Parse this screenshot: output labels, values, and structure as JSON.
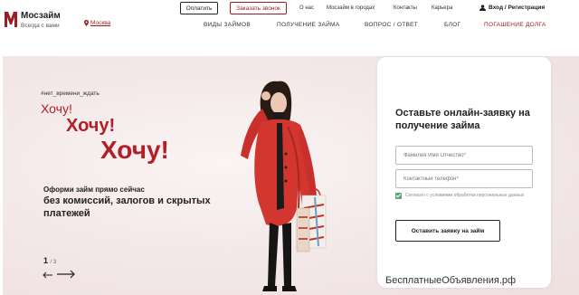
{
  "header": {
    "logo_name": "Мосзайм",
    "logo_tagline": "Всегда с вами",
    "city": "Москва",
    "pay_button": "Оплатить",
    "callback_button": "Заказать звонок",
    "top_links": [
      "О нас",
      "Мосзайм в городах",
      "Контакты",
      "Карьера"
    ],
    "login": "Вход / Регистрация",
    "nav": [
      "ВИДЫ ЗАЙМОВ",
      "ПОЛУЧЕНИЕ ЗАЙМА",
      "ВОПРОС / ОТВЕТ",
      "БЛОГ",
      "ПОГАШЕНИЕ ДОЛГА"
    ]
  },
  "hero": {
    "hashtag": "#нет_времени_ждать",
    "line1": "Хочу!",
    "line2": "Хочу!",
    "line3": "Хочу!",
    "offer_lead": "Оформи займ прямо сейчас",
    "offer_body": "без комиссий, залогов и скрытых платежей",
    "slide_current": "1",
    "slide_total": "/ 3"
  },
  "form": {
    "title": "Оставьте онлайн-заявку на получение займа",
    "name_placeholder": "Фамилия Имя Отчество*",
    "phone_placeholder": "Контактный телефон*",
    "consent_text": "Согласен с условиями обработки персональных данных",
    "consent_checked": true,
    "submit_label": "Оставить заявку на займ"
  },
  "watermark": "БесплатныеОбъявления.рф",
  "colors": {
    "brand": "#9c1c1f",
    "accent_red": "#b31f24",
    "hero_bg": "#f2e6e6",
    "checkbox_green": "#5aa870"
  },
  "icons": {
    "logo": "moszaim-m-logo",
    "city": "location-pin-icon",
    "login": "user-icon",
    "prev": "arrow-left-icon",
    "next": "arrow-right-icon"
  }
}
